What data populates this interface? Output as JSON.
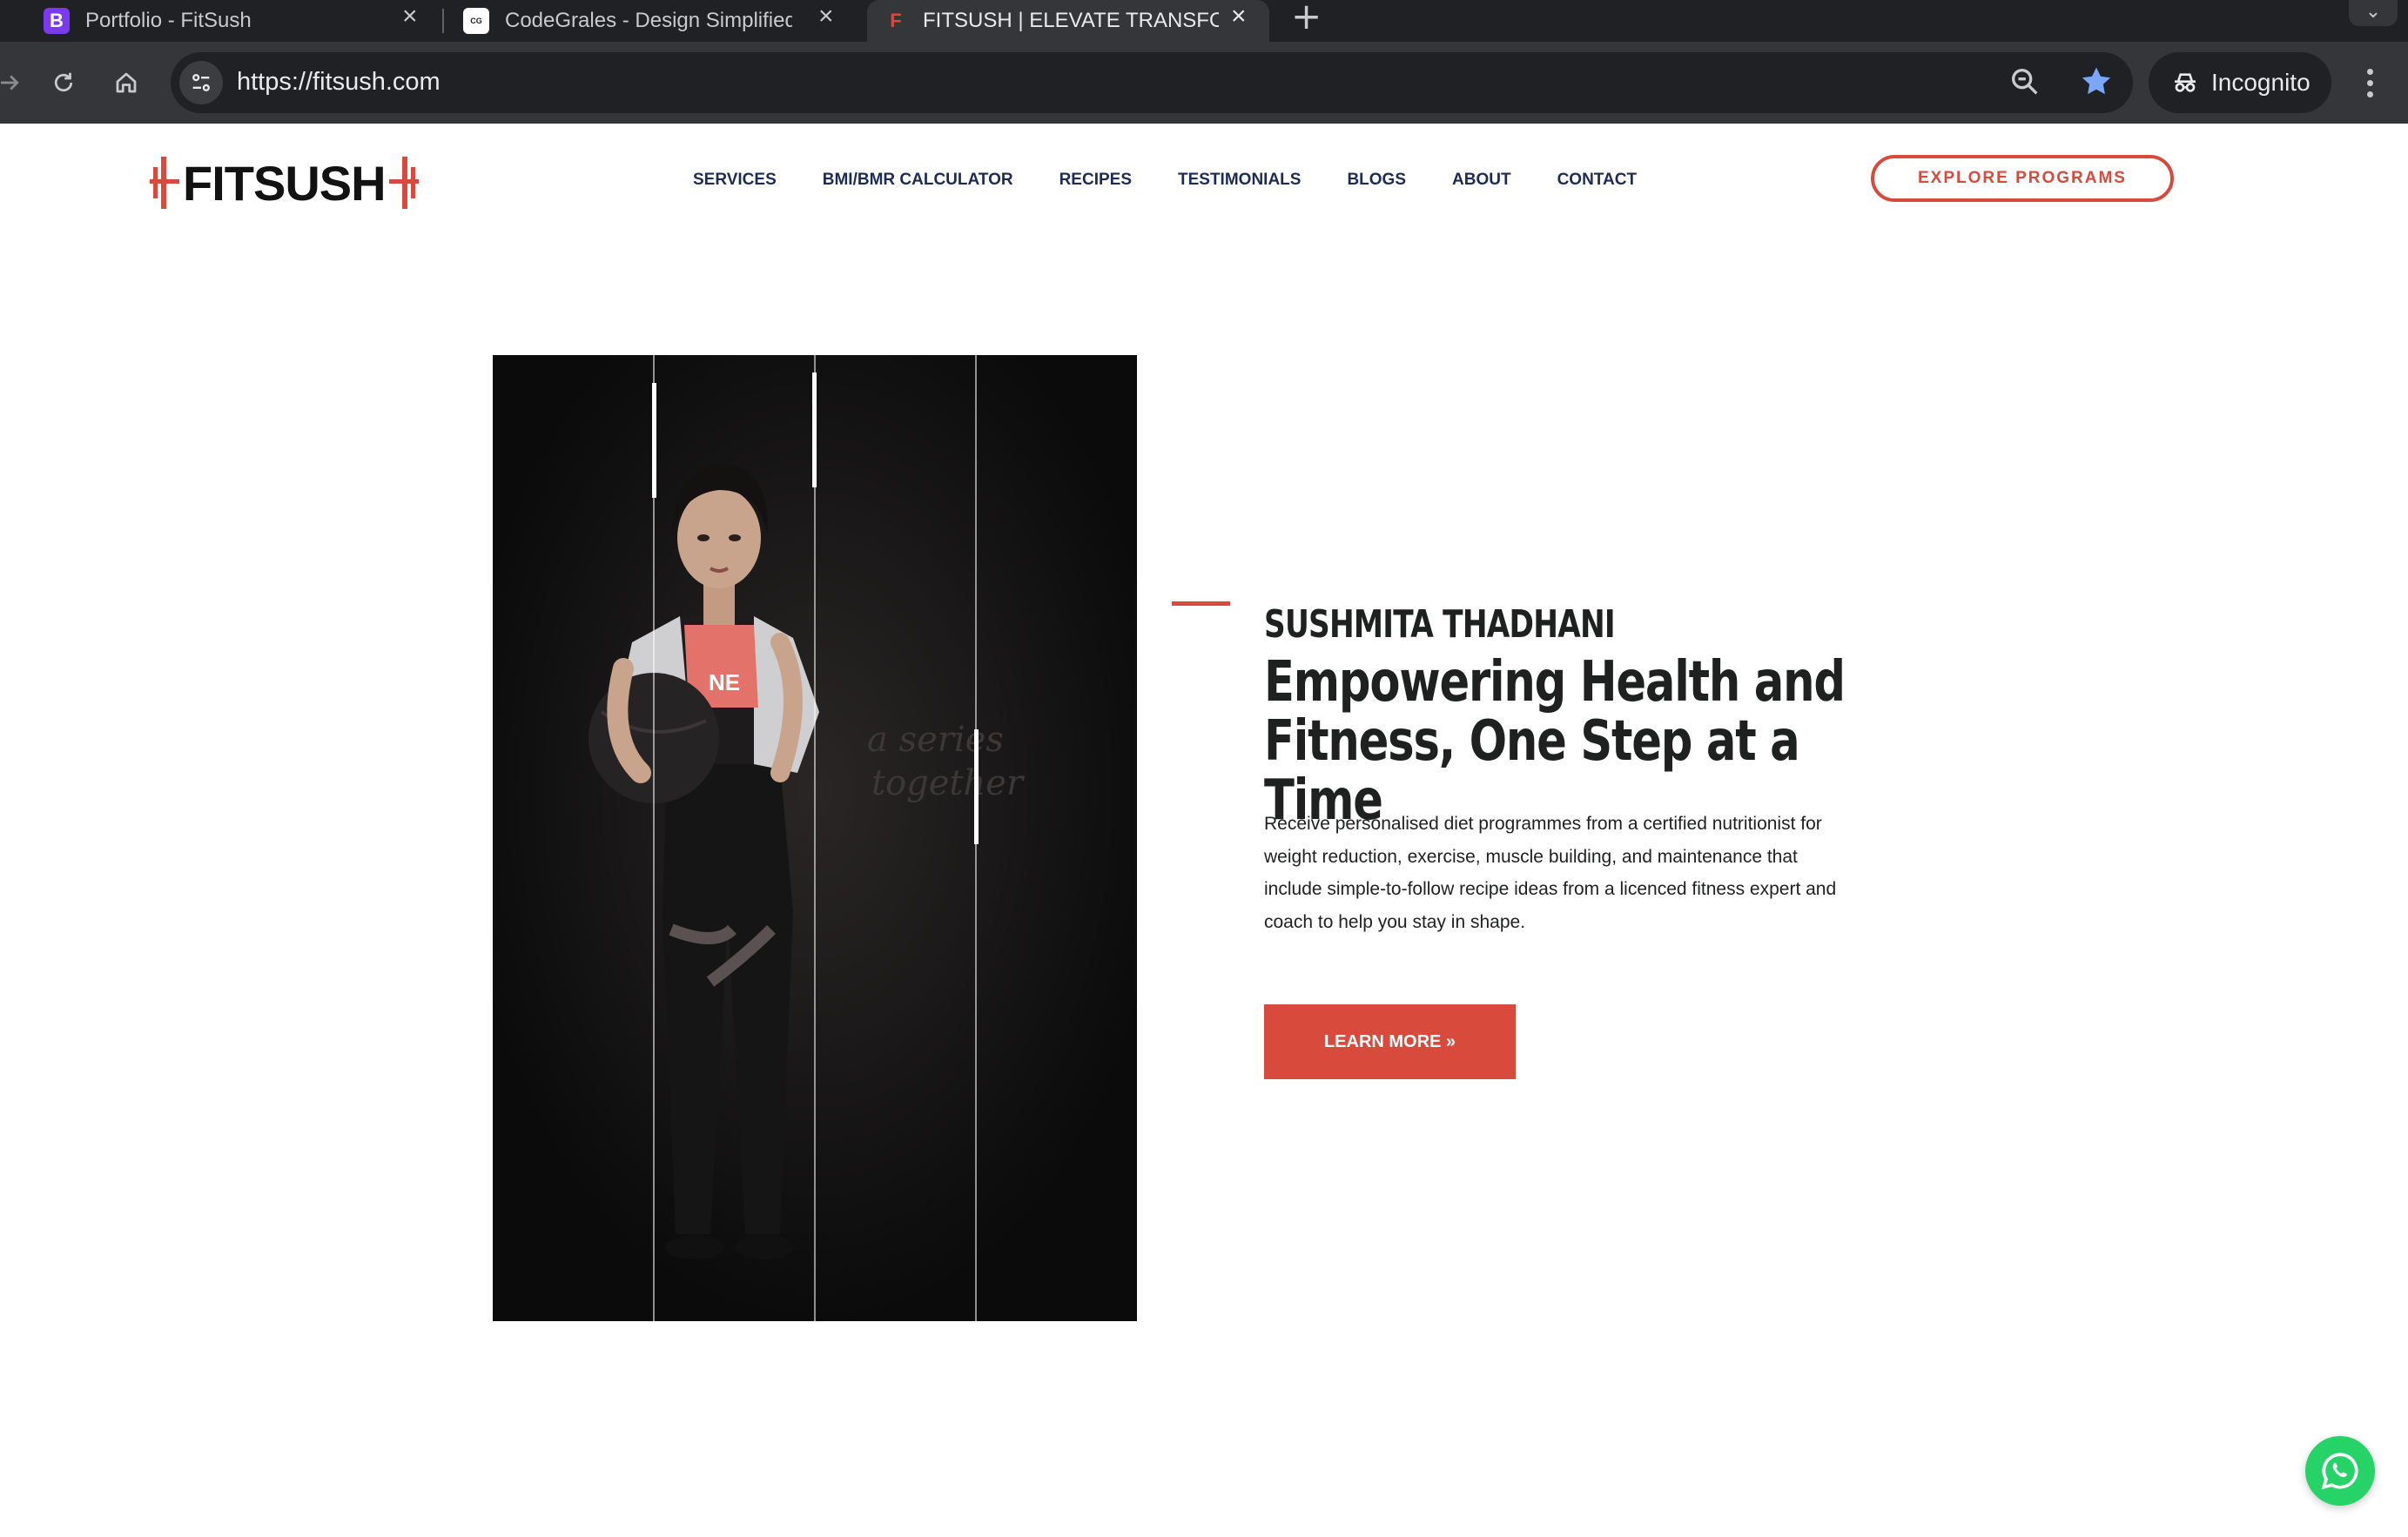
{
  "browser": {
    "tabs": [
      {
        "title": "Portfolio - FitSush",
        "favicon": "B",
        "favicon_color": "#7c3aed"
      },
      {
        "title": "CodeGrales - Design Simplified",
        "favicon": "CG"
      },
      {
        "title": "FITSUSH | ELEVATE TRANSFORM",
        "favicon": "F",
        "active": true
      }
    ],
    "url": "https://fitsush.com",
    "incognito_label": "Incognito"
  },
  "site": {
    "logo_text": "FITSUSH",
    "brand_color": "#d84a3c",
    "nav": [
      {
        "label": "SERVICES"
      },
      {
        "label": "BMI/BMR CALCULATOR"
      },
      {
        "label": "RECIPES"
      },
      {
        "label": "TESTIMONIALS"
      },
      {
        "label": "BLOGS"
      },
      {
        "label": "ABOUT"
      },
      {
        "label": "CONTACT"
      }
    ],
    "cta_label": "EXPLORE PROGRAMS"
  },
  "hero": {
    "photo_caption": "a series together",
    "name": "SUSHMITA THADHANI",
    "title_line1": "Empowering Health and",
    "title_line2": "Fitness, One Step at a Time",
    "description": "Receive personalised diet programmes from a certified nutritionist for weight reduction, exercise, muscle building, and maintenance that include simple-to-follow recipe ideas from a licenced fitness expert and coach to help you stay in shape.",
    "button_label": "LEARN MORE »"
  }
}
